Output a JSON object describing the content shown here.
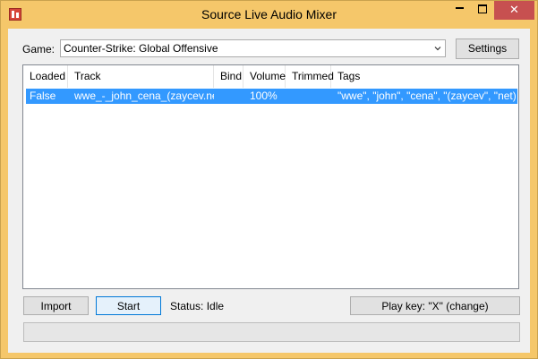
{
  "window": {
    "title": "Source Live Audio Mixer",
    "close_glyph": "✕"
  },
  "game": {
    "label": "Game:",
    "selected": "Counter-Strike: Global Offensive",
    "settings_label": "Settings"
  },
  "tracks": {
    "columns": [
      "Loaded",
      "Track",
      "Bind",
      "Volume",
      "Trimmed",
      "Tags"
    ],
    "rows": [
      {
        "loaded": "False",
        "track": "wwe_-_john_cena_(zaycev.net)",
        "bind": "",
        "volume": "100%",
        "trimmed": "",
        "tags": "\"wwe\", \"john\", \"cena\", \"(zaycev\", \"net)\"",
        "selected": true
      }
    ]
  },
  "controls": {
    "import_label": "Import",
    "start_label": "Start",
    "status": "Status: Idle",
    "play_key_label": "Play key: \"X\" (change)"
  },
  "progress": {
    "value": 0
  },
  "colors": {
    "titlebar": "#f5c76a",
    "selection": "#3399ff",
    "close": "#c75050"
  }
}
